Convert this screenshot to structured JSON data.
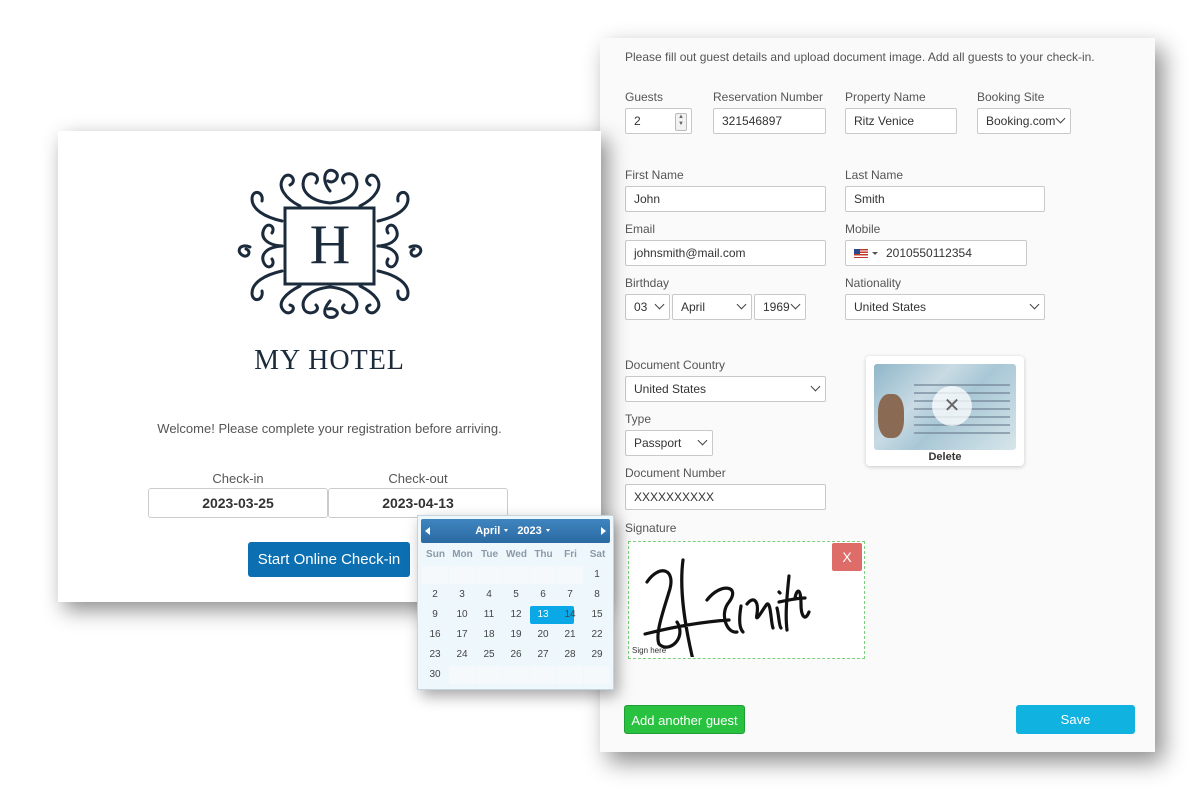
{
  "form": {
    "intro": "Please fill out guest details and upload document image. Add all guests to your check-in.",
    "guests": {
      "label": "Guests",
      "value": "2"
    },
    "reservation": {
      "label": "Reservation Number",
      "value": "321546897"
    },
    "property": {
      "label": "Property Name",
      "value": "Ritz Venice"
    },
    "booking_site": {
      "label": "Booking Site",
      "value": "Booking.com"
    },
    "first_name": {
      "label": "First Name",
      "value": "John"
    },
    "last_name": {
      "label": "Last Name",
      "value": "Smith"
    },
    "email": {
      "label": "Email",
      "value": "johnsmith@mail.com"
    },
    "mobile": {
      "label": "Mobile",
      "value": "2010550112354"
    },
    "birthday": {
      "label": "Birthday",
      "day": "03",
      "month": "April",
      "year": "1969"
    },
    "nationality": {
      "label": "Nationality",
      "value": "United States"
    },
    "doc_country": {
      "label": "Document Country",
      "value": "United States"
    },
    "doc_type": {
      "label": "Type",
      "value": "Passport"
    },
    "doc_number": {
      "label": "Document Number",
      "value": "XXXXXXXXXX"
    },
    "doc_image": {
      "delete_label": "Delete",
      "overlay_icon": "close-icon"
    },
    "signature": {
      "label": "Signature",
      "clear": "X",
      "hint": "Sign here",
      "ink_color": "#111111"
    },
    "add_guest": "Add another guest",
    "save": "Save"
  },
  "hotel": {
    "brand": "MY HOTEL",
    "monogram": "H",
    "welcome": "Welcome! Please complete your registration before arriving.",
    "checkin": {
      "label": "Check-in",
      "value": "2023-03-25"
    },
    "checkout": {
      "label": "Check-out",
      "value": "2023-04-13"
    },
    "start": "Start Online Check-in"
  },
  "calendar": {
    "month": "April",
    "year": "2023",
    "weekdays": [
      "Sun",
      "Mon",
      "Tue",
      "Wed",
      "Thu",
      "Fri",
      "Sat"
    ],
    "first_weekday_index": 6,
    "days_in_month": 30,
    "selected": 13
  },
  "colors": {
    "primary_blue": "#0b6fb1",
    "save_cyan": "#10b3e0",
    "add_green": "#28c240",
    "danger_red": "#d9534f",
    "calendar_header": "#2b6aa3",
    "calendar_selected": "#0aa8e6",
    "logo_navy": "#1b2b3c"
  }
}
